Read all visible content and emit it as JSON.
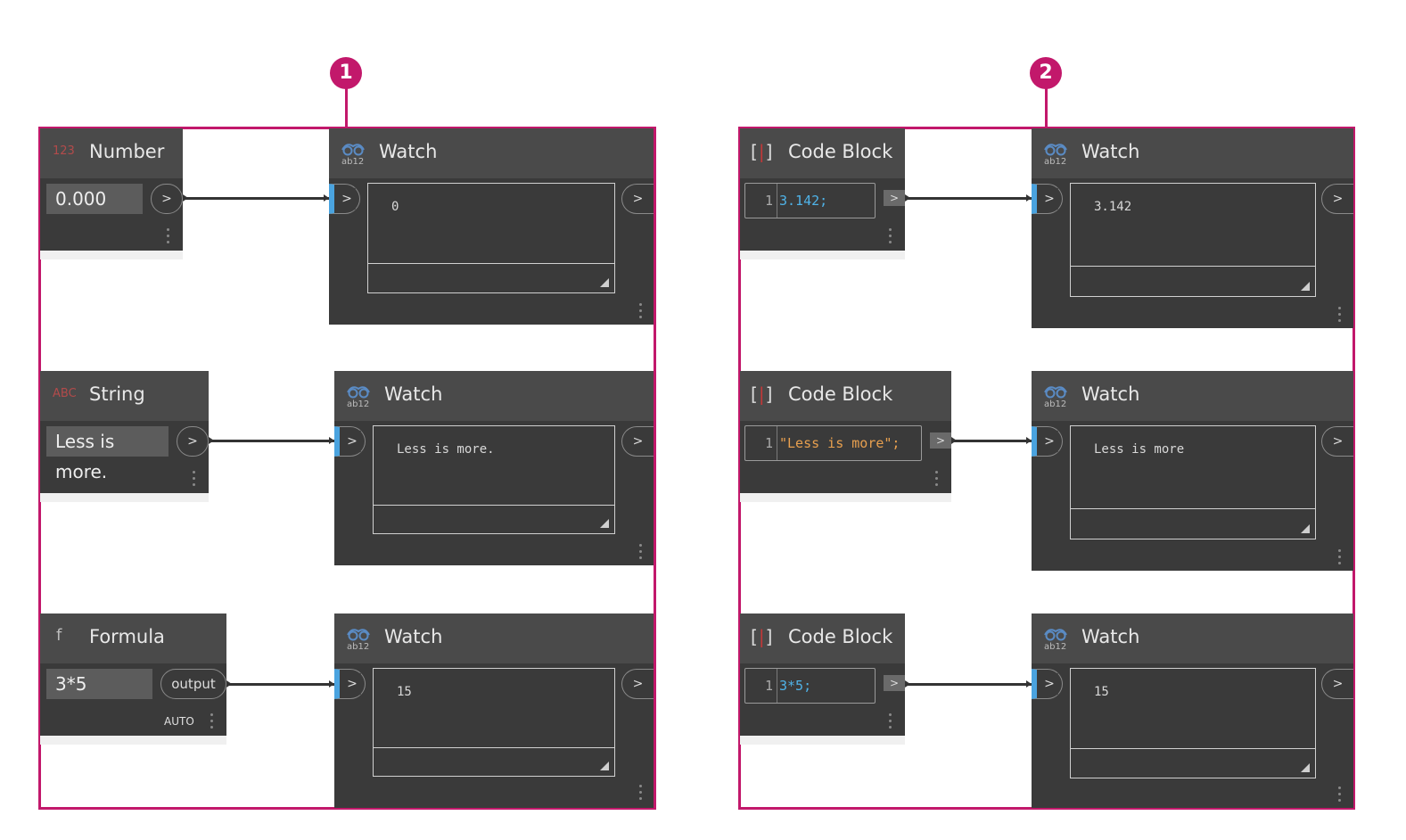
{
  "markers": [
    "1",
    "2"
  ],
  "panel1": {
    "number_node": {
      "title": "Number",
      "icon": "123",
      "value": "0.000",
      "port": ">"
    },
    "string_node": {
      "title": "String",
      "icon": "ABC",
      "value": "Less is more.",
      "port": ">"
    },
    "formula_node": {
      "title": "Formula",
      "icon": "f",
      "value": "3*5",
      "port": "output",
      "mode": "AUTO"
    },
    "watch1": {
      "title": "Watch",
      "value": "0",
      "in_port": ">",
      "out_port": ">"
    },
    "watch2": {
      "title": "Watch",
      "value": "Less is more.",
      "in_port": ">",
      "out_port": ">"
    },
    "watch3": {
      "title": "Watch",
      "value": "15",
      "in_port": ">",
      "out_port": ">"
    }
  },
  "panel2": {
    "code1": {
      "title": "Code Block",
      "line": "1",
      "code": "3.142;",
      "port": ">"
    },
    "code2": {
      "title": "Code Block",
      "line": "1",
      "code": "\"Less is more\";",
      "port": ">"
    },
    "code3": {
      "title": "Code Block",
      "line": "1",
      "code": "3*5;",
      "port": ">"
    },
    "watch1": {
      "title": "Watch",
      "value": "3.142",
      "in_port": ">",
      "out_port": ">"
    },
    "watch2": {
      "title": "Watch",
      "value": "Less is more",
      "in_port": ">",
      "out_port": ">"
    },
    "watch3": {
      "title": "Watch",
      "value": "15",
      "in_port": ">",
      "out_port": ">"
    }
  },
  "colors": {
    "accent": "#c2186b",
    "node_body": "#3a3a3a",
    "node_header": "#4a4a4a",
    "port_highlight": "#4aa3df",
    "code_number": "#4fb3e8",
    "code_string": "#e8a04f"
  }
}
